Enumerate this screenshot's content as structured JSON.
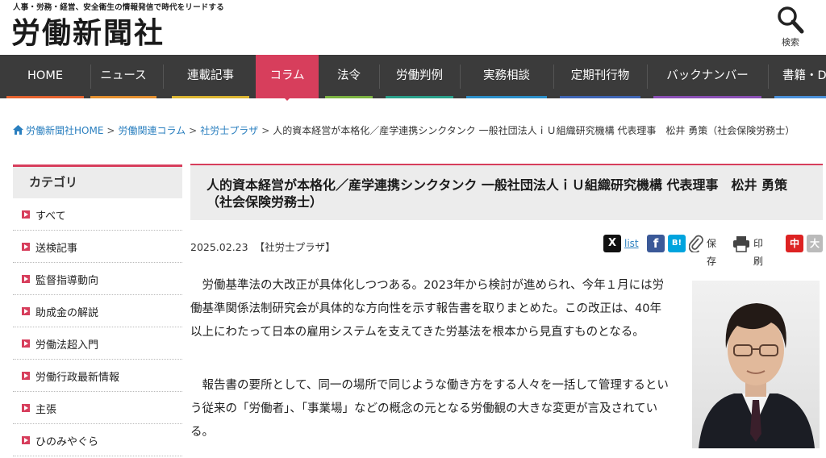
{
  "header": {
    "tagline": "人事・労務・経営、安全衛生の情報発信で時代をリードする",
    "logo": "労働新聞社",
    "search_label": "検索"
  },
  "nav": {
    "items": [
      {
        "label": "HOME"
      },
      {
        "label": "ニュース"
      },
      {
        "label": "連載記事"
      },
      {
        "label": "コラム"
      },
      {
        "label": "法令"
      },
      {
        "label": "労働判例"
      },
      {
        "label": "実務相談"
      },
      {
        "label": "定期刊行物"
      },
      {
        "label": "バックナンバー"
      },
      {
        "label": "書籍・D"
      }
    ],
    "active": "コラム",
    "accent_colors": [
      "#e4622f",
      "#e38f2f",
      "#dbb531",
      "#d73e5c",
      "#7cb342",
      "#2aa08a",
      "#2c8fc9",
      "#3f65b5",
      "#8a4fb5",
      "#4a90d9"
    ]
  },
  "breadcrumb": {
    "home": "労働新聞社HOME",
    "l1": "労働関連コラム",
    "l2": "社労士プラザ",
    "current": "人的資本経営が本格化／産学連携シンクタンク 一般社団法人ｉＵ組織研究機構 代表理事　松井 勇策（社会保険労務士）"
  },
  "sidebar": {
    "title": "カテゴリ",
    "items": [
      {
        "label": "すべて"
      },
      {
        "label": "送検記事"
      },
      {
        "label": "監督指導動向"
      },
      {
        "label": "助成金の解説"
      },
      {
        "label": "労働法超入門"
      },
      {
        "label": "労働行政最新情報"
      },
      {
        "label": "主張"
      },
      {
        "label": "ひのみやぐら"
      }
    ]
  },
  "article": {
    "title": "人的資本経営が本格化／産学連携シンクタンク 一般社団法人ｉＵ組織研究機構 代表理事　松井 勇策（社会保険労務士）",
    "date": "2025.02.23",
    "category": "【社労士プラザ】",
    "paragraphs": [
      "労働基準法の大改正が具体化しつつある。2023年から検討が進められ、今年１月には労働基準関係法制研究会が具体的な方向性を示す報告書を取りまとめた。この改正は、40年以上にわたって日本の雇用システムを支えてきた労基法を根本から見直すものとなる。",
      "報告書の要所として、同一の場所で同じような働き方をする人々を一括して管理するという従来の「労働者」、「事業場」などの概念の元となる労働観の大きな変更が言及されている。"
    ]
  },
  "share": {
    "x_icon": "X",
    "list_label": "list",
    "facebook_icon": "f",
    "hatena_icon": "B!",
    "save_label": "保存",
    "print_label": "印刷",
    "font_mid": "中",
    "font_large": "大"
  },
  "colors": {
    "accent": "#d73e5c",
    "nav_bg": "#3b3b3b",
    "link": "#2a7fbf"
  }
}
